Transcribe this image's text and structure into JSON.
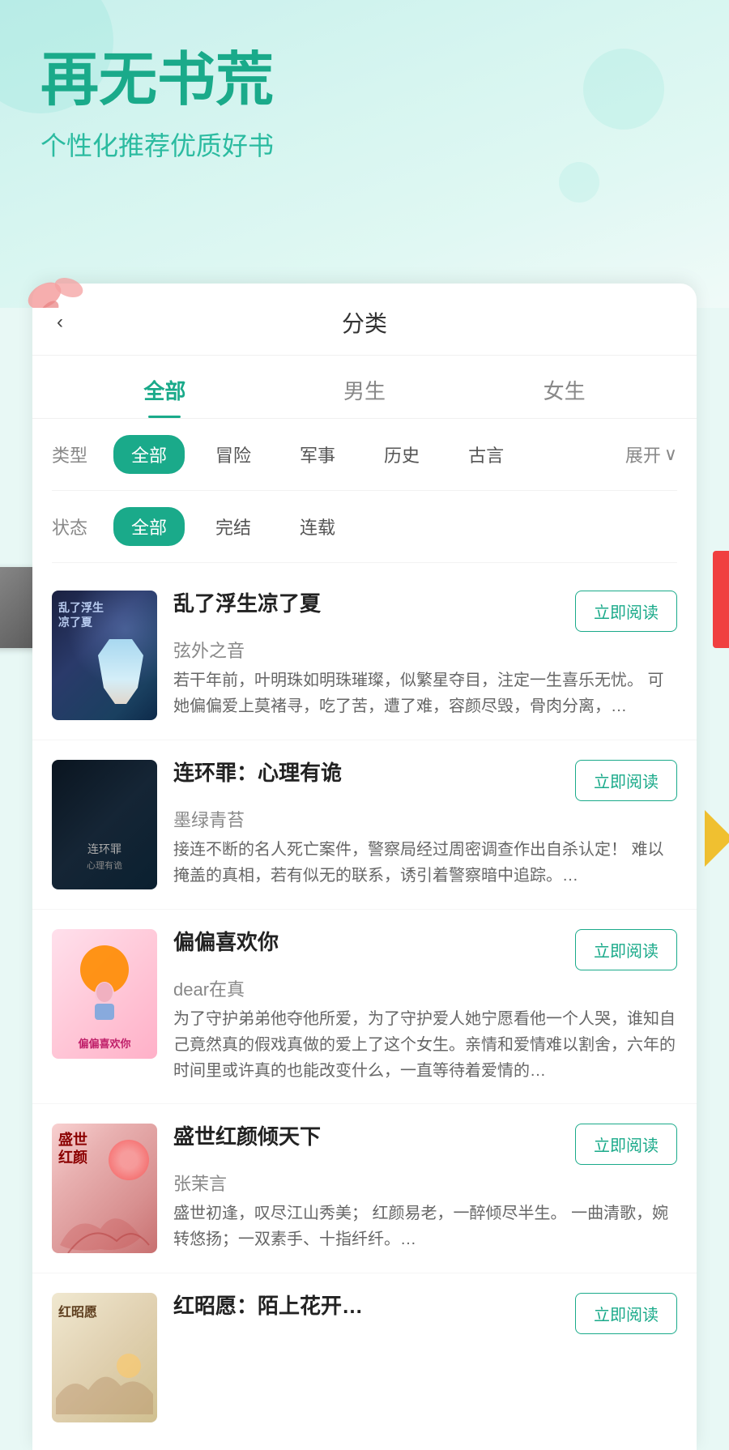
{
  "hero": {
    "title": "再无书荒",
    "subtitle": "个性化推荐优质好书"
  },
  "page": {
    "back_label": "‹",
    "title": "分类"
  },
  "gender_tabs": [
    {
      "id": "all",
      "label": "全部",
      "active": true
    },
    {
      "id": "male",
      "label": "男生",
      "active": false
    },
    {
      "id": "female",
      "label": "女生",
      "active": false
    }
  ],
  "type_filter": {
    "label": "类型",
    "chips": [
      {
        "id": "all",
        "label": "全部",
        "active": true
      },
      {
        "id": "adventure",
        "label": "冒险",
        "active": false
      },
      {
        "id": "military",
        "label": "军事",
        "active": false
      },
      {
        "id": "history",
        "label": "历史",
        "active": false
      },
      {
        "id": "ancient",
        "label": "古言",
        "active": false
      }
    ],
    "expand_label": "展开"
  },
  "status_filter": {
    "label": "状态",
    "chips": [
      {
        "id": "all",
        "label": "全部",
        "active": true
      },
      {
        "id": "finished",
        "label": "完结",
        "active": false
      },
      {
        "id": "ongoing",
        "label": "连载",
        "active": false
      }
    ]
  },
  "books": [
    {
      "id": 1,
      "title": "乱了浮生凉了夏",
      "author": "弦外之音",
      "desc": "若干年前，叶明珠如明珠璀璨，似繁星夺目，注定一生喜乐无忧。\n可她偏偏爱上莫褚寻，吃了苦，遭了难，容颜尽毁，骨肉分离，…",
      "read_btn": "立即阅读",
      "cover_type": "1"
    },
    {
      "id": 2,
      "title": "连环罪：心理有诡",
      "author": "墨绿青苔",
      "desc": "接连不断的名人死亡案件，警察局经过周密调查作出自杀认定！\n难以掩盖的真相，若有似无的联系，诱引着警察暗中追踪。…",
      "read_btn": "立即阅读",
      "cover_type": "2"
    },
    {
      "id": 3,
      "title": "偏偏喜欢你",
      "author": "dear在真",
      "desc": "为了守护弟弟他夺他所爱，为了守护爱人她宁愿看他一个人哭，谁知自己竟然真的假戏真做的爱上了这个女生。亲情和爱情难以割舍，六年的时间里或许真的也能改变什么，一直等待着爱情的…",
      "read_btn": "立即阅读",
      "cover_type": "3"
    },
    {
      "id": 4,
      "title": "盛世红颜倾天下",
      "author": "张茉言",
      "desc": "盛世初逢，叹尽江山秀美；\n红颜易老，一醉倾尽半生。\n一曲清歌，婉转悠扬；一双素手、十指纤纤。…",
      "read_btn": "立即阅读",
      "cover_type": "4"
    },
    {
      "id": 5,
      "title": "红昭愿：陌上花开…",
      "author": "",
      "desc": "",
      "read_btn": "立即阅读",
      "cover_type": "5"
    }
  ]
}
